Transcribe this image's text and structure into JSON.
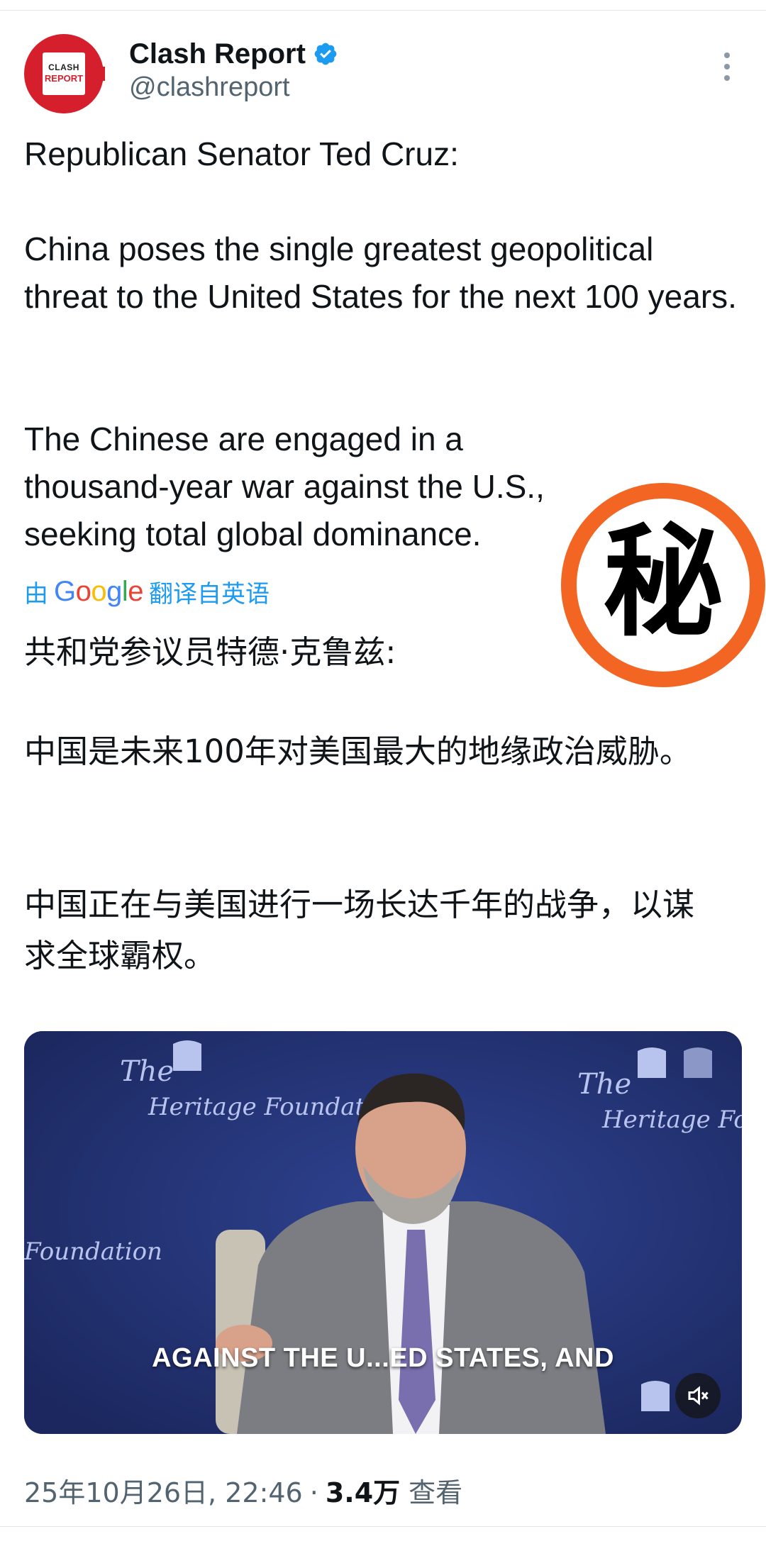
{
  "author": {
    "avatar_text_top": "CLASH",
    "avatar_text_bottom": "REPORT",
    "display_name": "Clash Report",
    "handle": "@clashreport"
  },
  "tweet": {
    "line_intro": "Republican Senator Ted Cruz:",
    "para1": "China poses the single greatest geopolitical threat to the United States for the next 100 years.",
    "para2": "The Chinese are engaged in a thousand-year war against the U.S., seeking total global dominance."
  },
  "translation": {
    "prefix": "由",
    "brand": "Google",
    "suffix": "翻译自英语",
    "line_intro": "共和党参议员特德·克鲁兹:",
    "para1": "中国是未来100年对美国最大的地缘政治威胁。",
    "para2": "中国正在与美国进行一场长达千年的战争，以谋求全球霸权。"
  },
  "stamp": {
    "char": "秘",
    "ring_color": "#f26522"
  },
  "video": {
    "caption": "AGAINST THE U...ED STATES, AND",
    "backdrop_text": [
      "The",
      "Heritage Foundation",
      "Foundation"
    ],
    "mute_icon": "speaker-muted-icon"
  },
  "meta": {
    "timestamp": "25年10月26日, 22:46",
    "separator": "·",
    "views_count": "3.4万",
    "views_label": "查看"
  },
  "colors": {
    "text": "#0f1419",
    "muted": "#536471",
    "link": "#1d9bf0",
    "verified": "#1d9bf0",
    "avatar": "#d61f2c"
  }
}
